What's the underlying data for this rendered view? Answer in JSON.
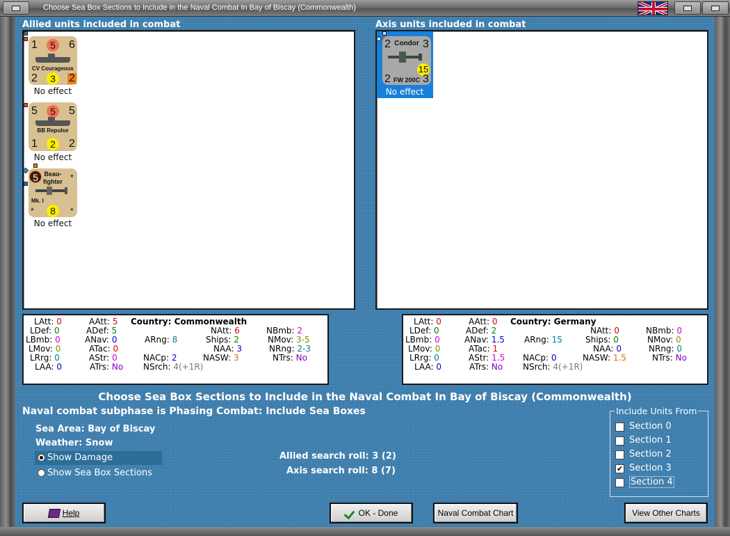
{
  "window": {
    "title": "Choose Sea Box Sections to Include in the Naval Combat In Bay of Biscay (Commonwealth)"
  },
  "allied": {
    "header": "Allied units included in combat",
    "units": [
      {
        "name": "CV Courageous",
        "tl": "1",
        "tc": "5",
        "tr": "6",
        "bl": "2",
        "bc": "3",
        "br": "2",
        "effect": "No effect"
      },
      {
        "name": "BB Repulse",
        "tl": "5",
        "tc": "5",
        "tr": "5",
        "bl": "1",
        "bc": "2",
        "br": "2",
        "effect": "No effect"
      },
      {
        "name_line1": "Beau-",
        "name_line2": "fighter",
        "sub": "Mk. I",
        "tl": "5",
        "tr": "*",
        "bl": "*",
        "bc": "8",
        "br": "*",
        "effect": "No effect"
      }
    ]
  },
  "axis": {
    "header": "Axis units included in combat",
    "units": [
      {
        "name_top": "Condor",
        "name_bottom": "FW 200C",
        "tl": "2",
        "tr": "3",
        "mid": "15",
        "bl": "2",
        "br": "3",
        "effect": "No effect"
      }
    ]
  },
  "allied_stats": {
    "country_label": "Country:",
    "country": "Commonwealth",
    "LAtt": "0",
    "LDef": "0",
    "LBmb": "0",
    "LMov": "0",
    "LRrg": "0",
    "LAA": "0",
    "AAtt": "5",
    "ADef": "5",
    "ANav": "0",
    "ATac": "0",
    "AStr": "0",
    "ATrs": "No",
    "ARng": "8",
    "NACp": "2",
    "NSrch": "4(+1R)",
    "NAtt": "6",
    "Ships": "2",
    "NAA": "3",
    "NASW": "3",
    "NBmb": "2",
    "NMov": "3-5",
    "NRng": "2-3",
    "NTrs": "No"
  },
  "axis_stats": {
    "country_label": "Country:",
    "country": "Germany",
    "LAtt": "0",
    "LDef": "0",
    "LBmb": "0",
    "LMov": "0",
    "LRrg": "0",
    "LAA": "0",
    "AAtt": "0",
    "ADef": "2",
    "ANav": "1.5",
    "ATac": "1",
    "AStr": "1.5",
    "ATrs": "No",
    "ARng": "15",
    "NACp": "0",
    "NSrch": "4(+1R)",
    "NAtt": "0",
    "Ships": "0",
    "NAA": "0",
    "NASW": "1.5",
    "NBmb": "0",
    "NMov": "0",
    "NRng": "0",
    "NTrs": "No"
  },
  "heading": "Choose Sea Box Sections to Include in the Naval Combat In Bay of Biscay (Commonwealth)",
  "subheading": "Naval combat subphase is Phasing Combat: Include Sea Boxes",
  "sea_area_label": "Sea Area:",
  "sea_area": "Bay of Biscay",
  "weather_label": "Weather:",
  "weather": "Snow",
  "radio": {
    "show_damage": "Show Damage",
    "show_sections": "Show Sea Box Sections",
    "selected": "show_damage"
  },
  "allied_search_label": "Allied search roll:",
  "allied_search": "3 (2)",
  "axis_search_label": "Axis search roll:",
  "axis_search": "8 (7)",
  "include": {
    "legend": "Include Units From",
    "sections": [
      {
        "label": "Section 0",
        "checked": false
      },
      {
        "label": "Section 1",
        "checked": false
      },
      {
        "label": "Section 2",
        "checked": false
      },
      {
        "label": "Section 3",
        "checked": true
      },
      {
        "label": "Section 4",
        "checked": false
      }
    ]
  },
  "buttons": {
    "help": "Help",
    "ok": "OK - Done",
    "naval_chart": "Naval Combat Chart",
    "other_charts": "View Other Charts"
  },
  "colors": {
    "panel_bg": "#3f7fae",
    "highlight": "#1a7fd8",
    "counter_allied": "#d8c090",
    "counter_axis": "#a8a8a8"
  }
}
